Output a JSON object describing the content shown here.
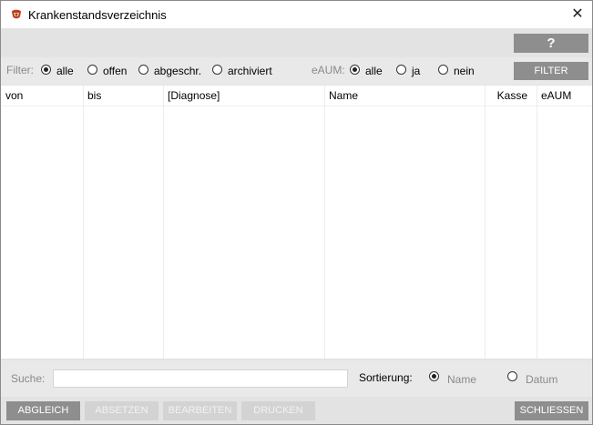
{
  "window": {
    "title": "Krankenstandsverzeichnis",
    "close_glyph": "✕",
    "app_icon": "app-icon"
  },
  "toolbar": {
    "help_label": "?"
  },
  "filter": {
    "label": "Filter:",
    "options": [
      "alle",
      "offen",
      "abgeschr.",
      "archiviert"
    ],
    "selected": "alle",
    "eaum_label": "eAUM:",
    "eaum_options": [
      "alle",
      "ja",
      "nein"
    ],
    "eaum_selected": "alle",
    "button_label": "FILTER"
  },
  "table": {
    "columns": [
      "von",
      "bis",
      "[Diagnose]",
      "Name",
      "Kasse",
      "eAUM"
    ],
    "rows": []
  },
  "search": {
    "label": "Suche:",
    "value": "",
    "sort_label": "Sortierung:",
    "sort_options": [
      "Name",
      "Datum"
    ],
    "sort_selected": "Name"
  },
  "footer": {
    "buttons": [
      "ABGLEICH",
      "ABSETZEN",
      "BEARBEITEN",
      "DRUCKEN"
    ],
    "close_label": "SCHLIESSEN"
  },
  "colors": {
    "button_dark": "#8e8e8e",
    "button_disabled": "#d3d3d3",
    "panel": "#e9e9e9"
  }
}
